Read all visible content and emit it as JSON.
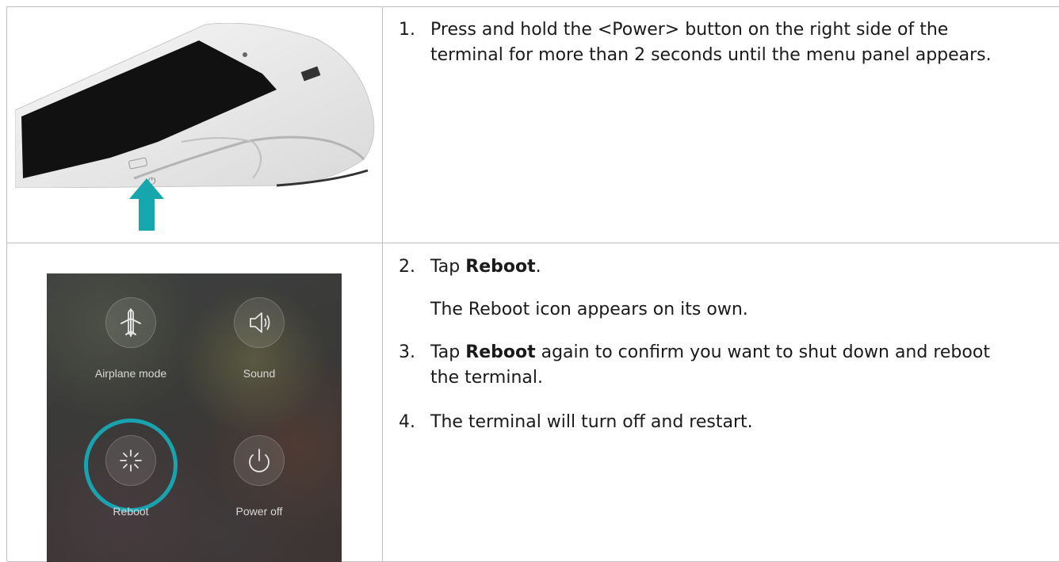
{
  "steps": [
    {
      "num": "1.",
      "text": "Press and hold the <Power> button on the right side of the terminal for more than 2 seconds until the menu panel appears.",
      "line1": "Press and hold the <Power> button on the right side of the",
      "line2": "terminal for more than 2 seconds until the menu panel appears."
    },
    {
      "num": "2.",
      "pre": "Tap ",
      "bold": "Reboot",
      "post": "."
    },
    {
      "num": "3.",
      "pre": "Tap ",
      "bold": "Reboot",
      "post": " again to confirm you want to shut down and reboot",
      "line2": "the terminal."
    },
    {
      "num": "4.",
      "text": "The terminal will turn off and restart."
    }
  ],
  "note": "The Reboot icon appears on its own.",
  "power_menu": {
    "items": [
      {
        "label": "Airplane mode",
        "icon": "airplane-icon"
      },
      {
        "label": "Sound",
        "icon": "sound-icon"
      },
      {
        "label": "Reboot",
        "icon": "reboot-icon",
        "highlighted": true
      },
      {
        "label": "Power off",
        "icon": "power-icon"
      }
    ]
  },
  "colors": {
    "accent": "#18a3ae",
    "border": "#bfbfbf"
  }
}
